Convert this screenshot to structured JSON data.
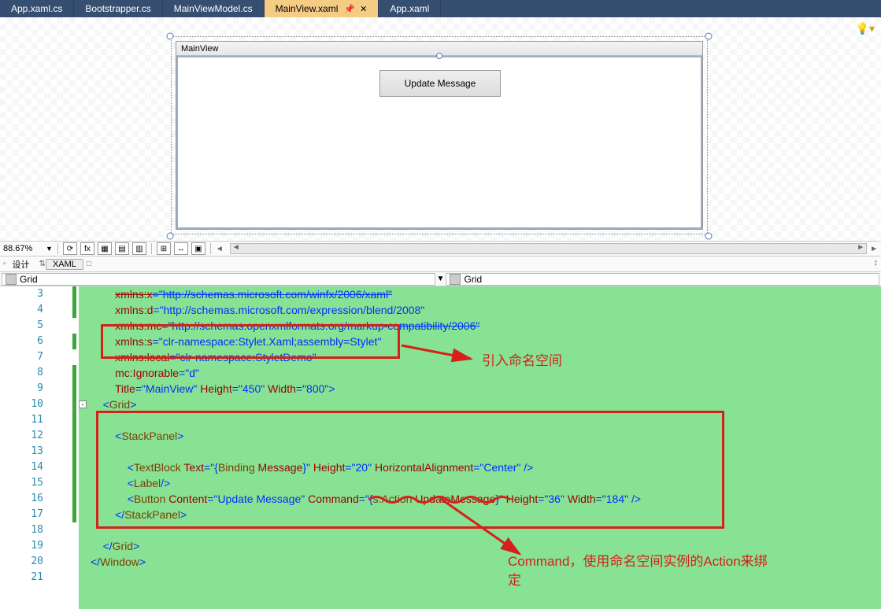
{
  "tabs": [
    {
      "label": "App.xaml.cs",
      "active": false
    },
    {
      "label": "Bootstrapper.cs",
      "active": false
    },
    {
      "label": "MainViewModel.cs",
      "active": false
    },
    {
      "label": "MainView.xaml",
      "active": true,
      "pinned": true,
      "closable": true
    },
    {
      "label": "App.xaml",
      "active": false
    }
  ],
  "designer": {
    "window_title": "MainView",
    "button_text": "Update Message",
    "bulb": "💡▾"
  },
  "toolbar": {
    "zoom": "88.67%",
    "refresh": "⟳",
    "fx": "fx",
    "design_label": "设计",
    "xaml_label": "XAML",
    "swap": "↕",
    "docsplit": "□",
    "arrows": "⇅"
  },
  "gridbar": {
    "left": "Grid",
    "right": "Grid"
  },
  "lines_start": 3,
  "code_lines": [
    {
      "indent": 2,
      "tokens": [
        [
          "c-red strike",
          "xmlns:x"
        ],
        [
          "c-blue strike",
          "="
        ],
        [
          "c-blue strike",
          "\"http://schemas.microsoft.com/winfx/2006/xaml\""
        ]
      ]
    },
    {
      "indent": 2,
      "tokens": [
        [
          "c-red",
          "xmlns:d"
        ],
        [
          "c-blue",
          "="
        ],
        [
          "c-blue",
          "\"http://schemas.microsoft.com/expression/blend/2008\""
        ]
      ]
    },
    {
      "indent": 2,
      "tokens": [
        [
          "c-red strike",
          "xmlns:mc"
        ],
        [
          "c-blue strike",
          "="
        ],
        [
          "c-blue strike",
          "\"http://schemas.openxmlformats.org/markup-compatibility/2006\""
        ]
      ]
    },
    {
      "indent": 2,
      "tokens": [
        [
          "c-red",
          "xmlns:s"
        ],
        [
          "c-blue",
          "="
        ],
        [
          "c-blue",
          "\"clr-namespace:Stylet.Xaml;assembly=Stylet\""
        ]
      ]
    },
    {
      "indent": 2,
      "tokens": [
        [
          "c-red strike",
          "xmlns:local"
        ],
        [
          "c-blue strike",
          "="
        ],
        [
          "c-blue strike",
          "\"clr-namespace:StyletDemo\""
        ]
      ]
    },
    {
      "indent": 2,
      "tokens": [
        [
          "c-red",
          "mc:Ignorable"
        ],
        [
          "c-blue",
          "="
        ],
        [
          "c-blue",
          "\"d\""
        ]
      ]
    },
    {
      "indent": 2,
      "tokens": [
        [
          "c-red",
          "Title"
        ],
        [
          "c-blue",
          "=\"MainView\""
        ],
        [
          "c-red",
          " Height"
        ],
        [
          "c-blue",
          "=\"450\""
        ],
        [
          "c-red",
          " Width"
        ],
        [
          "c-blue",
          "=\"800\""
        ],
        [
          "c-blue",
          ">"
        ]
      ]
    },
    {
      "indent": 1,
      "tokens": [
        [
          "c-blue",
          "<"
        ],
        [
          "c-brown",
          "Grid"
        ],
        [
          "c-blue",
          ">"
        ]
      ]
    },
    {
      "indent": 0,
      "tokens": []
    },
    {
      "indent": 2,
      "tokens": [
        [
          "c-blue",
          "<"
        ],
        [
          "c-brown",
          "StackPanel"
        ],
        [
          "c-blue",
          ">"
        ]
      ]
    },
    {
      "indent": 0,
      "tokens": []
    },
    {
      "indent": 3,
      "tokens": [
        [
          "c-blue",
          "<"
        ],
        [
          "c-brown",
          "TextBlock"
        ],
        [
          "c-red",
          " Text"
        ],
        [
          "c-blue",
          "=\""
        ],
        [
          "c-blue",
          "{"
        ],
        [
          "c-brown",
          "Binding"
        ],
        [
          "c-red",
          " Message"
        ],
        [
          "c-blue",
          "}\""
        ],
        [
          "c-red",
          " Height"
        ],
        [
          "c-blue",
          "=\"20\""
        ],
        [
          "c-red",
          " HorizontalAlignment"
        ],
        [
          "c-blue",
          "=\"Center\" />"
        ]
      ]
    },
    {
      "indent": 3,
      "tokens": [
        [
          "c-blue",
          "<"
        ],
        [
          "c-brown",
          "Label"
        ],
        [
          "c-blue",
          "/>"
        ]
      ]
    },
    {
      "indent": 3,
      "tokens": [
        [
          "c-blue",
          "<"
        ],
        [
          "c-brown",
          "Button"
        ],
        [
          "c-red",
          " Content"
        ],
        [
          "c-blue",
          "=\"Update Message\""
        ],
        [
          "c-red",
          " Command"
        ],
        [
          "c-blue",
          "=\""
        ],
        [
          "c-blue",
          "{"
        ],
        [
          "c-brown",
          "s:Action"
        ],
        [
          "c-red",
          " UpdateMessage"
        ],
        [
          "c-blue",
          "}\""
        ],
        [
          "c-red",
          " Height"
        ],
        [
          "c-blue",
          "=\"36\""
        ],
        [
          "c-red",
          " Width"
        ],
        [
          "c-blue",
          "=\"184\" />"
        ]
      ]
    },
    {
      "indent": 2,
      "tokens": [
        [
          "c-blue",
          "</"
        ],
        [
          "c-brown",
          "StackPanel"
        ],
        [
          "c-blue",
          ">"
        ]
      ]
    },
    {
      "indent": 0,
      "tokens": []
    },
    {
      "indent": 1,
      "tokens": [
        [
          "c-blue",
          "</"
        ],
        [
          "c-brown",
          "Grid"
        ],
        [
          "c-blue",
          ">"
        ]
      ]
    },
    {
      "indent": 0,
      "tokens": [
        [
          "c-blue",
          "</"
        ],
        [
          "c-brown",
          "Window"
        ],
        [
          "c-blue",
          ">"
        ]
      ]
    },
    {
      "indent": 0,
      "tokens": []
    }
  ],
  "annotations": {
    "label1": "引入命名空间",
    "label2": "Command，使用命名空间实例的Action来绑定"
  }
}
